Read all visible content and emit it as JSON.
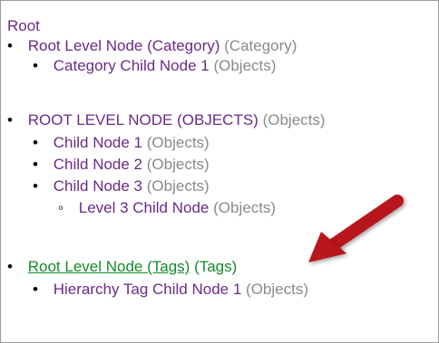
{
  "root": {
    "label": "Root"
  },
  "tree": {
    "n1": {
      "label": "Root Level Node (Category)",
      "type": "(Category)"
    },
    "n1c1": {
      "label": "Category Child Node 1",
      "type": "(Objects)"
    },
    "n2": {
      "label": "ROOT LEVEL NODE (OBJECTS)",
      "type": "(Objects)"
    },
    "n2c1": {
      "label": "Child Node 1",
      "type": "(Objects)"
    },
    "n2c2": {
      "label": "Child Node 2",
      "type": "(Objects)"
    },
    "n2c3": {
      "label": "Child Node 3",
      "type": "(Objects)"
    },
    "n2c3c1": {
      "label": "Level 3 Child Node",
      "type": "(Objects)"
    },
    "n3": {
      "label": "Root Level Node (Tags)",
      "type": "(Tags)"
    },
    "n3c1": {
      "label": "Hierarchy Tag Child Node 1",
      "type": "(Objects)"
    }
  },
  "colors": {
    "link_purple": "#6b2a87",
    "type_gray": "#8a8a8a",
    "active_green": "#138b28",
    "arrow_red": "#b8141d"
  },
  "icons": {
    "arrow": "red-pointer-arrow-icon",
    "bullet": "bullet-dot-icon",
    "bullet_circle": "bullet-circle-icon"
  }
}
